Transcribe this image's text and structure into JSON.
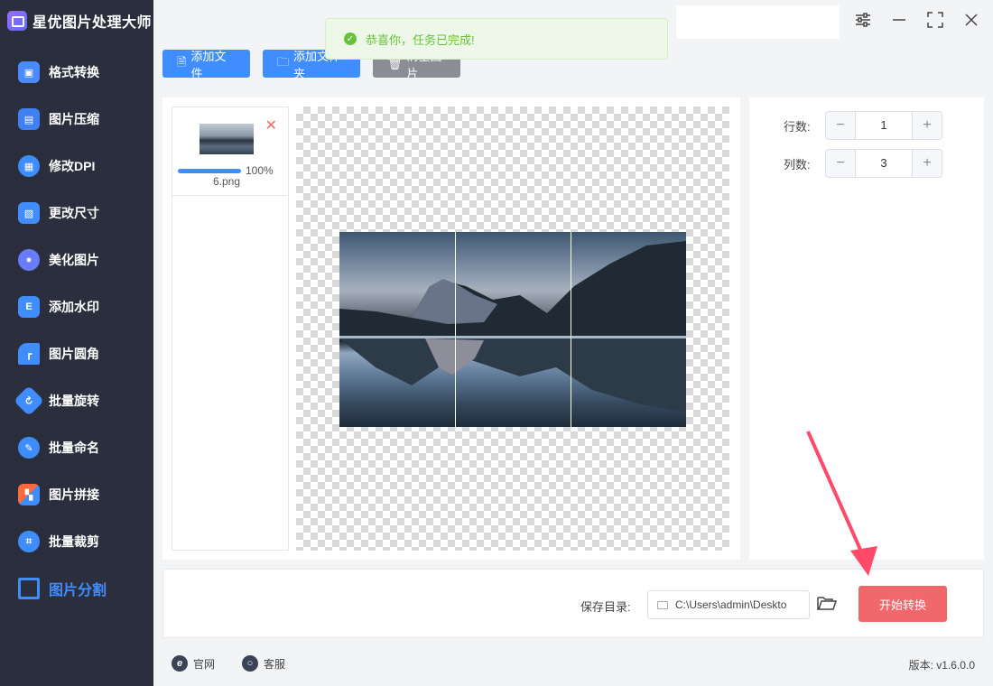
{
  "app": {
    "title": "星优图片处理大师"
  },
  "sidebar": {
    "items": [
      {
        "label": "格式转换",
        "icon": "image-convert-icon",
        "color": "#4a8cff"
      },
      {
        "label": "图片压缩",
        "icon": "image-compress-icon",
        "color": "#3f7ff0"
      },
      {
        "label": "修改DPI",
        "icon": "dpi-icon",
        "color": "#3f8dff"
      },
      {
        "label": "更改尺寸",
        "icon": "resize-icon",
        "color": "#3f8dff"
      },
      {
        "label": "美化图片",
        "icon": "beautify-icon",
        "color": "#6b7bff"
      },
      {
        "label": "添加水印",
        "icon": "watermark-icon",
        "color": "#3f8dff"
      },
      {
        "label": "图片圆角",
        "icon": "rounded-corner-icon",
        "color": "#3f8dff"
      },
      {
        "label": "批量旋转",
        "icon": "rotate-icon",
        "color": "#3f8dff"
      },
      {
        "label": "批量命名",
        "icon": "rename-icon",
        "color": "#3f8dff"
      },
      {
        "label": "图片拼接",
        "icon": "stitch-icon",
        "color": "#ff6a3f"
      },
      {
        "label": "批量裁剪",
        "icon": "crop-icon",
        "color": "#3f8dff"
      },
      {
        "label": "图片分割",
        "icon": "split-icon",
        "color": "#3f8dff",
        "active": true
      }
    ]
  },
  "toolbar": {
    "add_file": "添加文件",
    "add_folder": "添加文件夹",
    "clear": "清空图片"
  },
  "toast": {
    "message": "恭喜你，任务已完成!"
  },
  "file": {
    "name": "6.png",
    "progress_text": "100%",
    "progress": 1.0
  },
  "settings": {
    "rows_label": "行数:",
    "rows_value": "1",
    "cols_label": "列数:",
    "cols_value": "3"
  },
  "bottom": {
    "save_label": "保存目录:",
    "save_path": "C:\\Users\\admin\\Deskto",
    "start_button": "开始转换"
  },
  "footer": {
    "website": "官网",
    "service": "客服",
    "version": "版本: v1.6.0.0"
  },
  "colors": {
    "accent": "#3f8dff",
    "start": "#f0686c",
    "sidebar": "#2b2e3c",
    "success": "#67c23a"
  }
}
